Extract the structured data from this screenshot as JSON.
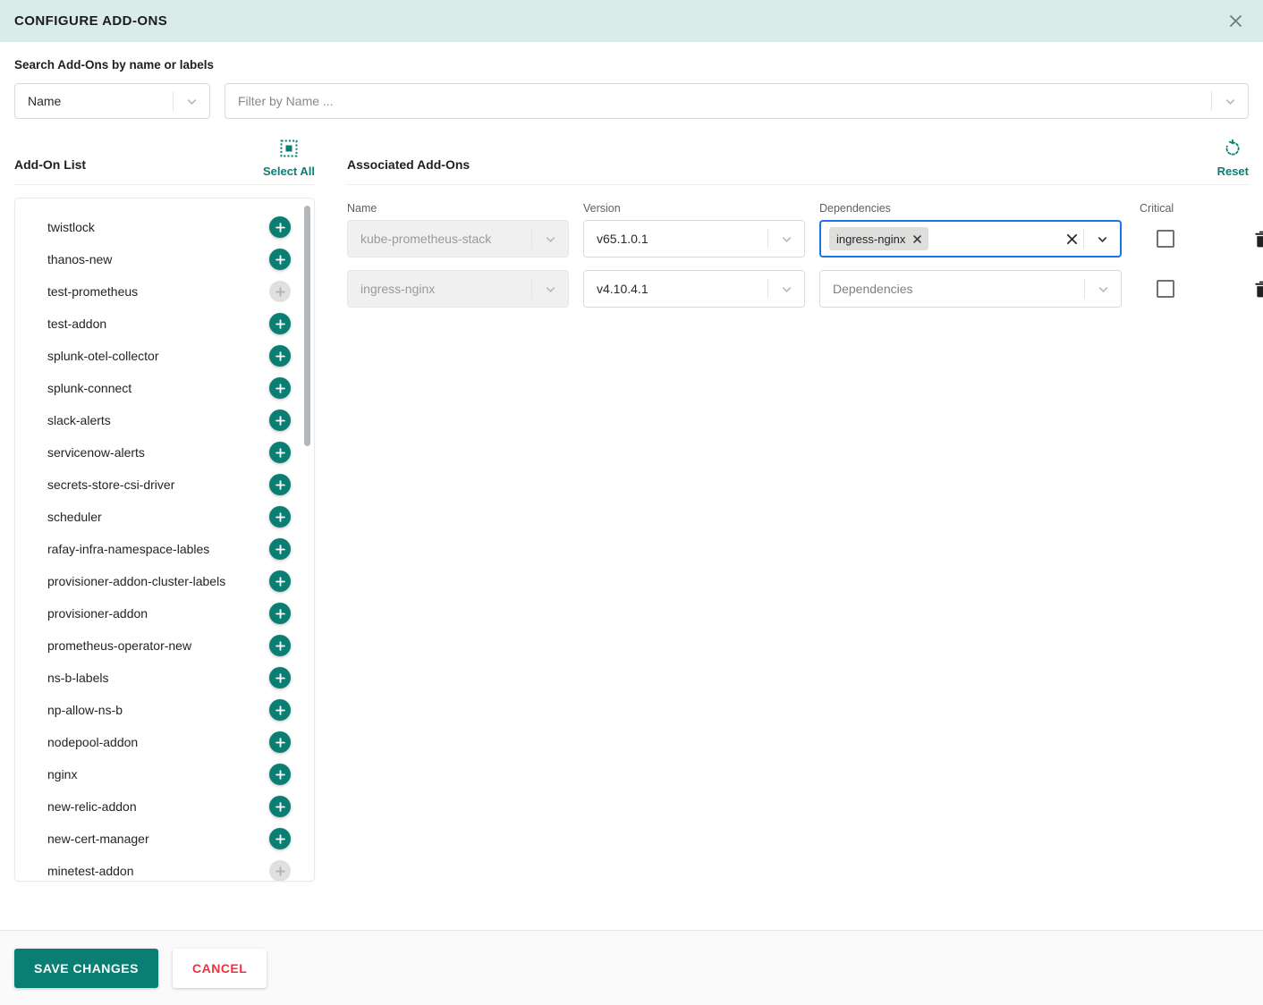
{
  "dialog": {
    "title": "CONFIGURE ADD-ONS",
    "close_icon": "close-icon"
  },
  "search": {
    "label": "Search Add-Ons by name or labels",
    "type_select_value": "Name",
    "filter_placeholder": "Filter by Name ..."
  },
  "addon_list": {
    "title": "Add-On List",
    "select_all_label": "Select All",
    "select_all_icon": "select-all-icon",
    "items": [
      {
        "name": "twistlock",
        "disabled": false
      },
      {
        "name": "thanos-new",
        "disabled": false
      },
      {
        "name": "test-prometheus",
        "disabled": true
      },
      {
        "name": "test-addon",
        "disabled": false
      },
      {
        "name": "splunk-otel-collector",
        "disabled": false
      },
      {
        "name": "splunk-connect",
        "disabled": false
      },
      {
        "name": "slack-alerts",
        "disabled": false
      },
      {
        "name": "servicenow-alerts",
        "disabled": false
      },
      {
        "name": "secrets-store-csi-driver",
        "disabled": false
      },
      {
        "name": "scheduler",
        "disabled": false
      },
      {
        "name": "rafay-infra-namespace-lables",
        "disabled": false
      },
      {
        "name": "provisioner-addon-cluster-labels",
        "disabled": false
      },
      {
        "name": "provisioner-addon",
        "disabled": false
      },
      {
        "name": "prometheus-operator-new",
        "disabled": false
      },
      {
        "name": "ns-b-labels",
        "disabled": false
      },
      {
        "name": "np-allow-ns-b",
        "disabled": false
      },
      {
        "name": "nodepool-addon",
        "disabled": false
      },
      {
        "name": "nginx",
        "disabled": false
      },
      {
        "name": "new-relic-addon",
        "disabled": false
      },
      {
        "name": "new-cert-manager",
        "disabled": false
      },
      {
        "name": "minetest-addon",
        "disabled": true
      }
    ]
  },
  "associated": {
    "title": "Associated Add-Ons",
    "reset_label": "Reset",
    "reset_icon": "reset-icon",
    "columns": {
      "name": "Name",
      "version": "Version",
      "dependencies": "Dependencies",
      "critical": "Critical"
    },
    "dependencies_placeholder": "Dependencies",
    "rows": [
      {
        "name": "kube-prometheus-stack",
        "version": "v65.1.0.1",
        "dependency_chips": [
          "ingress-nginx"
        ],
        "dependencies_focused": true,
        "critical_checked": false,
        "delete_icon": "trash-icon"
      },
      {
        "name": "ingress-nginx",
        "version": "v4.10.4.1",
        "dependency_chips": [],
        "dependencies_focused": false,
        "critical_checked": false,
        "delete_icon": "trash-icon"
      }
    ]
  },
  "footer": {
    "save_label": "SAVE CHANGES",
    "cancel_label": "CANCEL"
  },
  "colors": {
    "header_bg": "#d9ecea",
    "accent": "#0a7e73",
    "danger": "#f0303a",
    "focus_border": "#1a73e8"
  }
}
